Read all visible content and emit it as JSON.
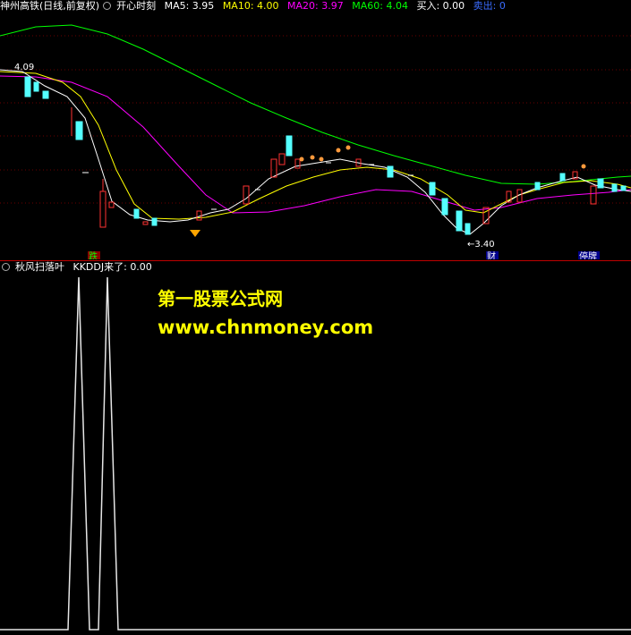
{
  "top_header": {
    "stock_name": "神州高铁(日线,前复权)",
    "indicator_name": "开心时刻",
    "ma5": "MA5: 3.95",
    "ma10": "MA10: 4.00",
    "ma20": "MA20: 3.97",
    "ma60": "MA60: 4.04",
    "buy": "买入: 0.00",
    "sell": "卖出: 0"
  },
  "bottom_header": {
    "indicator_name": "秋风扫落叶",
    "kkddj": "KKDDJ来了: 0.00"
  },
  "price_annotations": {
    "high_label": "4.09",
    "low_label": "←3.40"
  },
  "event_tags": {
    "die": "跌",
    "cai": "财",
    "tingpai": "停牌"
  },
  "watermark": {
    "title": "第一股票公式网",
    "url": "www.chnmoney.com"
  },
  "colors": {
    "ma5": "#ffffff",
    "ma10": "#ffff00",
    "ma20": "#ff00ff",
    "ma60": "#00ff00",
    "up_candle": "#ff3232",
    "down_candle": "#54ffff",
    "grid": "#800000"
  }
}
